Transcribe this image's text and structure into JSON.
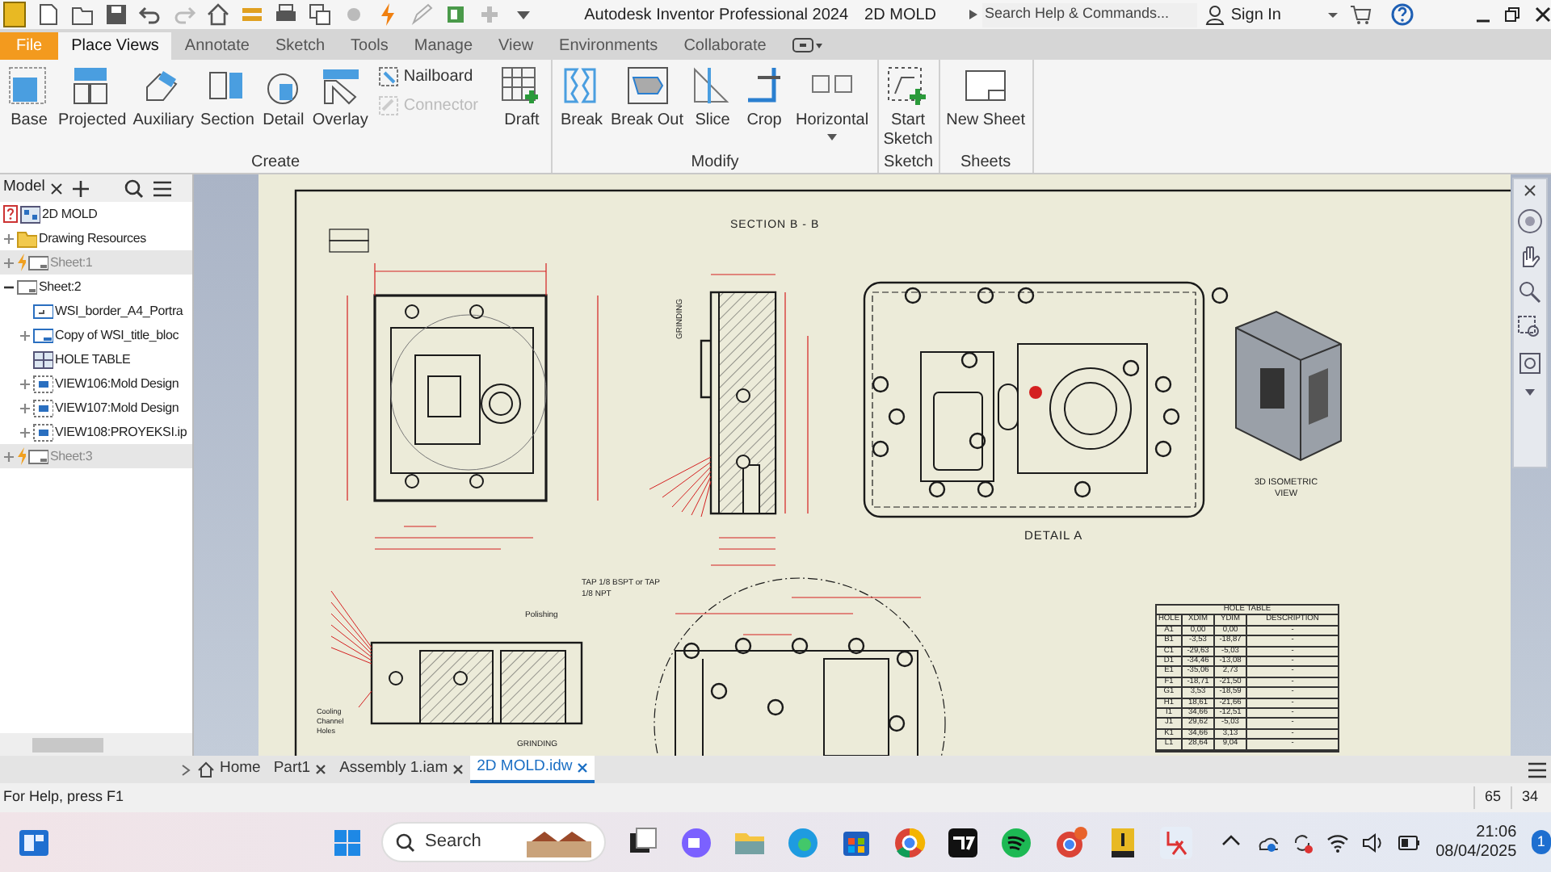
{
  "window": {
    "title": "Autodesk Inventor Professional 2024",
    "document": "2D MOLD"
  },
  "search": {
    "placeholder": "Search Help & Commands..."
  },
  "sign_in": "Sign In",
  "ribbon_tabs": [
    {
      "label": "File",
      "kind": "file",
      "selected": false
    },
    {
      "label": "Place Views",
      "kind": "tab",
      "selected": true
    },
    {
      "label": "Annotate",
      "kind": "tab",
      "selected": false
    },
    {
      "label": "Sketch",
      "kind": "tab",
      "selected": false
    },
    {
      "label": "Tools",
      "kind": "tab",
      "selected": false
    },
    {
      "label": "Manage",
      "kind": "tab",
      "selected": false
    },
    {
      "label": "View",
      "kind": "tab",
      "selected": false
    },
    {
      "label": "Environments",
      "kind": "tab",
      "selected": false
    },
    {
      "label": "Collaborate",
      "kind": "tab",
      "selected": false
    }
  ],
  "ribbon_groups": [
    {
      "label": "Create",
      "commands": [
        {
          "label": "Base",
          "kind": "large",
          "disabled": false
        },
        {
          "label": "Projected",
          "kind": "large",
          "disabled": false
        },
        {
          "label": "Auxiliary",
          "kind": "large",
          "disabled": false
        },
        {
          "label": "Section",
          "kind": "large",
          "disabled": false
        },
        {
          "label": "Detail",
          "kind": "large",
          "disabled": false
        },
        {
          "label": "Overlay",
          "kind": "large",
          "disabled": false
        },
        {
          "label": "Nailboard",
          "kind": "small",
          "disabled": false
        },
        {
          "label": "Connector",
          "kind": "small",
          "disabled": true
        },
        {
          "label": "Draft",
          "kind": "large",
          "disabled": false
        }
      ]
    },
    {
      "label": "Modify",
      "commands": [
        {
          "label": "Break",
          "kind": "large",
          "disabled": false
        },
        {
          "label": "Break Out",
          "kind": "large",
          "disabled": false
        },
        {
          "label": "Slice",
          "kind": "large",
          "disabled": false
        },
        {
          "label": "Crop",
          "kind": "large",
          "disabled": false
        },
        {
          "label": "Horizontal",
          "kind": "dropdown",
          "disabled": false
        }
      ]
    },
    {
      "label": "Sketch",
      "commands": [
        {
          "label": "Start Sketch",
          "kind": "large",
          "disabled": false
        }
      ]
    },
    {
      "label": "Sheets",
      "commands": [
        {
          "label": "New Sheet",
          "kind": "large",
          "disabled": false
        }
      ]
    }
  ],
  "browser": {
    "tab": "Model",
    "tree": [
      {
        "label": "2D MOLD",
        "kind": "document",
        "disabled": false,
        "children": [
          {
            "label": "Drawing Resources",
            "kind": "folder",
            "expanded": false,
            "disabled": false
          },
          {
            "label": "Sheet:1",
            "kind": "sheet",
            "expanded": false,
            "disabled": true
          },
          {
            "label": "Sheet:2",
            "kind": "sheet",
            "expanded": true,
            "disabled": false,
            "children": [
              {
                "label": "WSI_border_A4_Portra",
                "kind": "border"
              },
              {
                "label": "Copy of WSI_title_bloc",
                "kind": "title",
                "expanded": false
              },
              {
                "label": "HOLE TABLE",
                "kind": "table"
              },
              {
                "label": "VIEW106:Mold Design",
                "kind": "view",
                "expanded": false
              },
              {
                "label": "VIEW107:Mold Design",
                "kind": "view",
                "expanded": false
              },
              {
                "label": "VIEW108:PROYEKSI.ip",
                "kind": "view",
                "expanded": false
              }
            ]
          },
          {
            "label": "Sheet:3",
            "kind": "sheet",
            "expanded": false,
            "disabled": true
          }
        ]
      }
    ]
  },
  "sheet": {
    "section_title": "SECTION B - B",
    "detail_title": "DETAIL A",
    "iso_label": "3D ISOMETRIC VIEW",
    "annotations": [
      {
        "text": "TAP 1/8 BSPT or TAP 1/8 NPT",
        "kind": "note"
      },
      {
        "text": "Polishing",
        "kind": "note"
      },
      {
        "text": "GRINDING",
        "kind": "vertical"
      },
      {
        "text": "GRINDING",
        "kind": "note"
      },
      {
        "text": "Cooling Channel Holes",
        "kind": "note"
      }
    ],
    "hole_table": {
      "title": "HOLE TABLE",
      "columns": [
        "HOLE",
        "XDIM",
        "YDIM",
        "DESCRIPTION"
      ],
      "rows": [
        [
          "A1",
          "0,00",
          "0,00",
          "-"
        ],
        [
          "B1",
          "-3,53",
          "-18,87",
          "-"
        ],
        [
          "C1",
          "-29,63",
          "-5,03",
          "-"
        ],
        [
          "D1",
          "-34,46",
          "-13,08",
          "-"
        ],
        [
          "E1",
          "-35,06",
          "2,73",
          "-"
        ],
        [
          "F1",
          "-18,71",
          "-21,50",
          "-"
        ],
        [
          "G1",
          "3,53",
          "-18,59",
          "-"
        ],
        [
          "H1",
          "18,61",
          "-21,66",
          "-"
        ],
        [
          "I1",
          "34,66",
          "-12,51",
          "-"
        ],
        [
          "J1",
          "29,62",
          "-5,03",
          "-"
        ],
        [
          "K1",
          "34,66",
          "3,13",
          "-"
        ],
        [
          "L1",
          "28,64",
          "9,04",
          "-"
        ]
      ]
    }
  },
  "document_tabs": [
    {
      "label": "Home",
      "kind": "home",
      "selected": false
    },
    {
      "label": "Part1",
      "kind": "doc",
      "selected": false
    },
    {
      "label": "Assembly 1.iam",
      "kind": "doc",
      "selected": false
    },
    {
      "label": "2D MOLD.idw",
      "kind": "doc",
      "selected": true
    }
  ],
  "status_bar": {
    "help": "For Help, press F1",
    "values": [
      "65",
      "34"
    ]
  },
  "taskbar": {
    "search": "Search",
    "time": "21:06",
    "date": "08/04/2025",
    "notifications": "1"
  }
}
